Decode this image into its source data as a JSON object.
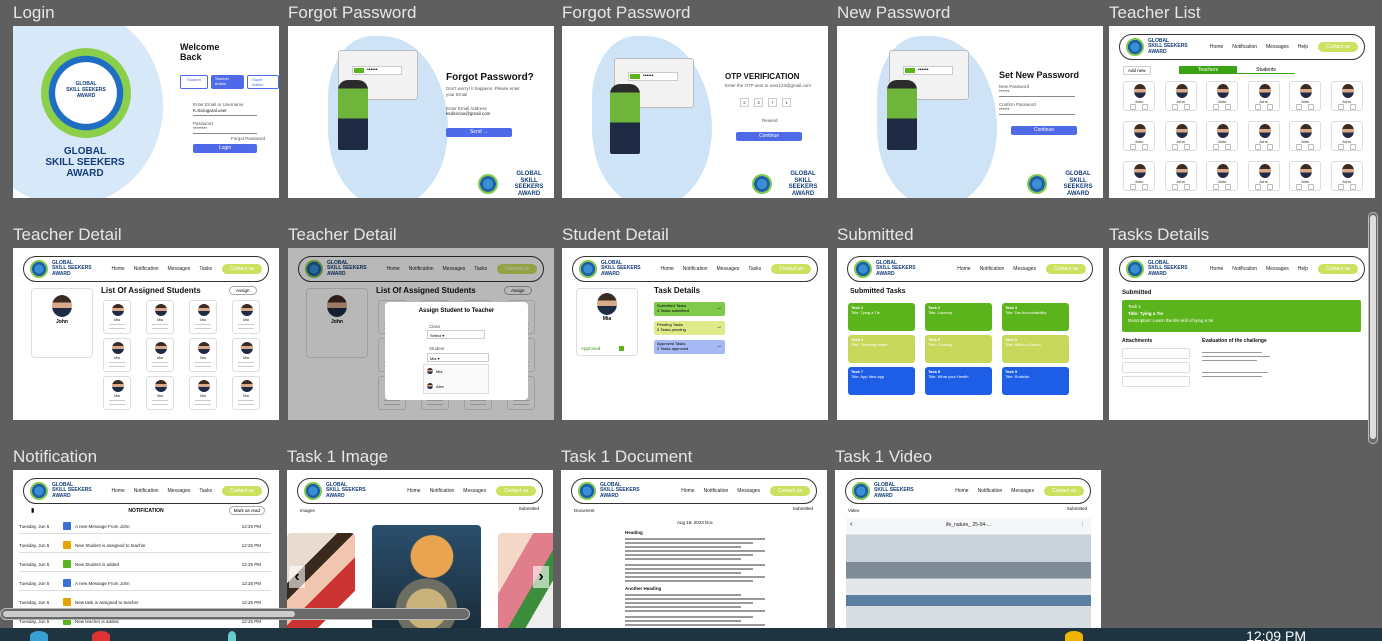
{
  "frames": [
    {
      "label": "Login"
    },
    {
      "label": "Forgot Password"
    },
    {
      "label": "Forgot Password"
    },
    {
      "label": "New Password"
    },
    {
      "label": "Teacher List"
    },
    {
      "label": "Teacher Detail"
    },
    {
      "label": "Teacher Detail"
    },
    {
      "label": "Student Detail"
    },
    {
      "label": "Submitted"
    },
    {
      "label": "Tasks Details"
    },
    {
      "label": "Notification"
    },
    {
      "label": "Task 1 Image"
    },
    {
      "label": "Task 1 Document"
    },
    {
      "label": "Task 1 Video"
    }
  ],
  "brand": {
    "line1": "GLOBAL",
    "line2": "SKILL SEEKERS",
    "line3": "AWARD",
    "ring_top": "EMPOWERING FUTURES",
    "ring_bottom": "ONE SKILL AT A TIME"
  },
  "nav": {
    "home": "Home",
    "notification": "Notification",
    "messages": "Messages",
    "tasks": "Tasks",
    "help": "Help",
    "contact": "Contact us"
  },
  "login": {
    "welcome": "Welcome Back",
    "tab1": "Student",
    "tab2": "Teacher Admin",
    "tab3": "Super Admin",
    "user_label": "Enter Email or Username",
    "user_value": "K.Sarugaral.user",
    "pass_label": "Password",
    "pass_value": "********",
    "forgot": "Forgot Password",
    "button": "Login"
  },
  "forgot": {
    "title": "Forgot Password?",
    "desc": "Don't worry! It happens. Please enter your Email",
    "email_label": "Enter Email Address",
    "email_value": "ksdirecao@gmail.com",
    "button": "Send"
  },
  "otp": {
    "title": "OTP VERIFICATION",
    "desc": "Enter the OTP sent to user123@gmail.com",
    "digits": [
      "2",
      "3",
      "7",
      "1"
    ],
    "resend": "Resend",
    "button": "Continue"
  },
  "newpass": {
    "title": "Set New Password",
    "label1": "New Password",
    "value1": "******",
    "label2": "Confirm Password",
    "value2": "******",
    "button": "Continue"
  },
  "teacher_list": {
    "add": "Add new",
    "tab_teachers": "Teachers",
    "tab_students": "Students",
    "name": "John"
  },
  "teacher_detail": {
    "heading": "List Of Assigned Students",
    "assign": "Assign",
    "teacher_name": "John",
    "student_name": "Mia"
  },
  "assign_modal": {
    "title": "Assign Student to Teacher",
    "class_label": "Class",
    "class_value": "Select",
    "student_label": "Student",
    "student_value": "Mia",
    "options": [
      "Mia",
      "Alex"
    ]
  },
  "student_detail": {
    "heading": "Task Details",
    "name": "Mia",
    "approved": "Approved",
    "items": [
      {
        "title": "Submitted Tasks",
        "sub": "4 Tasks submitted"
      },
      {
        "title": "Pending Tasks",
        "sub": "5 Tasks pending"
      },
      {
        "title": "Approved Tasks",
        "sub": "2 Tasks approved"
      }
    ]
  },
  "submitted": {
    "heading": "Submitted Tasks",
    "tasks": [
      {
        "n": "Task 1",
        "t": "Title: Tying a Tie"
      },
      {
        "n": "Task 4",
        "t": "Title: Trending Water"
      },
      {
        "n": "Task 7",
        "t": "Title: App Idea app"
      },
      {
        "n": "Task 2",
        "t": "Title: Laundry"
      },
      {
        "n": "Task 5",
        "t": "Title: Cooking"
      },
      {
        "n": "Task 8",
        "t": "Title: What your Health"
      },
      {
        "n": "Task 3",
        "t": "Title: Tax Accountability"
      },
      {
        "n": "Task 6",
        "t": "Title: Stitch a Button"
      },
      {
        "n": "Task 9",
        "t": "Title: Rubbish"
      }
    ]
  },
  "task_details": {
    "heading": "Submitted",
    "task": "Task 1",
    "title": "Title: Tying a Tie",
    "desc": "Description: Learn the life skill of tying a tie",
    "attachments": "Attachments",
    "evaluation": "Evaluation of the challenge"
  },
  "notification": {
    "heading": "NOTIFICATION",
    "mark": "Mark as read",
    "rows": [
      {
        "date": "Tuesday, Jun 5",
        "msg": "A new Message From John",
        "time": "12:25 PM"
      },
      {
        "date": "Tuesday, Jun 5",
        "msg": "New Student is assigned to teacher",
        "time": "12:25 PM"
      },
      {
        "date": "Tuesday, Jun 5",
        "msg": "New Student is added",
        "time": "12:25 PM"
      },
      {
        "date": "Tuesday, Jun 5",
        "msg": "A new Message From John",
        "time": "12:25 PM"
      },
      {
        "date": "Tuesday, Jun 5",
        "msg": "New task is assigned to teacher",
        "time": "12:25 PM"
      },
      {
        "date": "Tuesday, Jun 5",
        "msg": "New teacher is added",
        "time": "12:25 PM"
      }
    ]
  },
  "task_image": {
    "label": "Images",
    "status": "Submitted"
  },
  "task_doc": {
    "label": "Document",
    "status": "Submitted",
    "date": "Aug 18, 2023 Doc",
    "h1": "Heading",
    "h2": "Another Heading"
  },
  "task_video": {
    "label": "Video",
    "status": "Submitted",
    "file": "ife_nature_ 25-04-..."
  },
  "taskbar": {
    "clock": "12:09 PM"
  },
  "colors": {
    "green": "#5cb41c",
    "lime": "#c8d85a",
    "blue": "#1e5ee6",
    "accent": "#4e6ae8"
  }
}
